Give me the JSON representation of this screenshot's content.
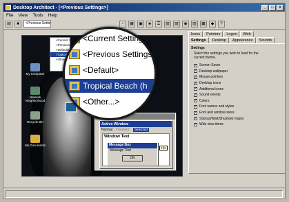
{
  "window": {
    "title": "Desktop Architect - [<Previous Settings>]"
  },
  "menu": [
    "File",
    "View",
    "Tools",
    "Help"
  ],
  "toolbar": {
    "theme_combo": "<Previous Settings>"
  },
  "themes": {
    "small_items": [
      "<Current Settings>",
      "<Previous Settings>",
      "<Default>",
      "Tropical Beach",
      "<Other...>"
    ],
    "magnified_items": [
      "<Current Settings>",
      "<Previous Settings>",
      "<Default>",
      "Tropical Beach (h",
      "<Other...>"
    ],
    "selected": "Tropical Beach"
  },
  "desktop_icons": [
    "My Computer",
    "Network Neighborhood",
    "Recycle Bin",
    "My Documents"
  ],
  "sample": {
    "inactive_title": "Inactive Window",
    "active_title": "Active Window",
    "menu": [
      "Normal",
      "Disabled",
      "Selected"
    ],
    "window_text": "Window Text",
    "message_box_title": "Message Box",
    "message_text": "Message Text",
    "ok": "OK",
    "tooltip": "Info"
  },
  "settings": {
    "tabs_row1": [
      "Icons",
      "Pointers",
      "Logos",
      "Web"
    ],
    "tabs_row2": [
      "Settings",
      "Desktop",
      "Appearance",
      "Sounds"
    ],
    "header": "Settings",
    "description": "Select the settings you wish to load for the current theme.",
    "options": [
      "Screen Saver",
      "Desktop wallpaper",
      "Mouse pointers",
      "Desktop icons",
      "Additional icons",
      "Sound events",
      "Colors",
      "Font names and styles",
      "Font and window sizes",
      "Startup/Wait/Shutdown logos",
      "Web view items"
    ]
  }
}
